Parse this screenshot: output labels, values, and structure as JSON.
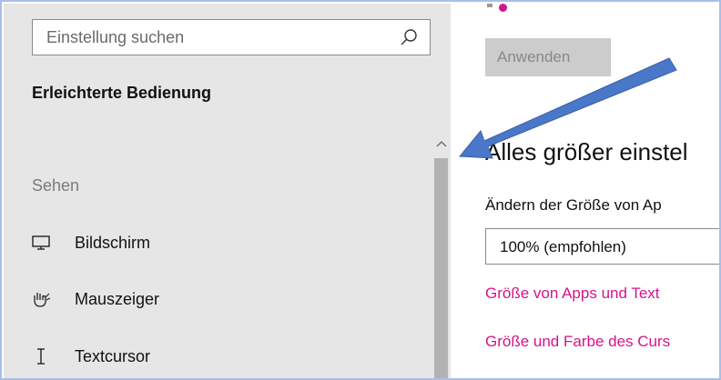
{
  "search": {
    "placeholder": "Einstellung suchen",
    "icon": "search-icon"
  },
  "sidebar": {
    "section_title": "Erleichterte Bedienung",
    "group_label": "Sehen",
    "items": [
      {
        "label": "Bildschirm",
        "icon": "monitor-icon"
      },
      {
        "label": "Mauszeiger",
        "icon": "mouse-pointer-icon"
      },
      {
        "label": "Textcursor",
        "icon": "text-cursor-icon"
      }
    ]
  },
  "main": {
    "apply_label": "Anwenden",
    "heading": "Alles größer einstel",
    "size_label": "Ändern der Größe von Ap",
    "scale_value": "100% (empfohlen)",
    "links": [
      "Größe von Apps und Text",
      "Größe und Farbe des Curs"
    ]
  },
  "colors": {
    "accent": "#d4138b",
    "arrow": "#4a78c8",
    "sidebar_bg": "#e6e6e6",
    "frame": "#a9bfe8"
  }
}
